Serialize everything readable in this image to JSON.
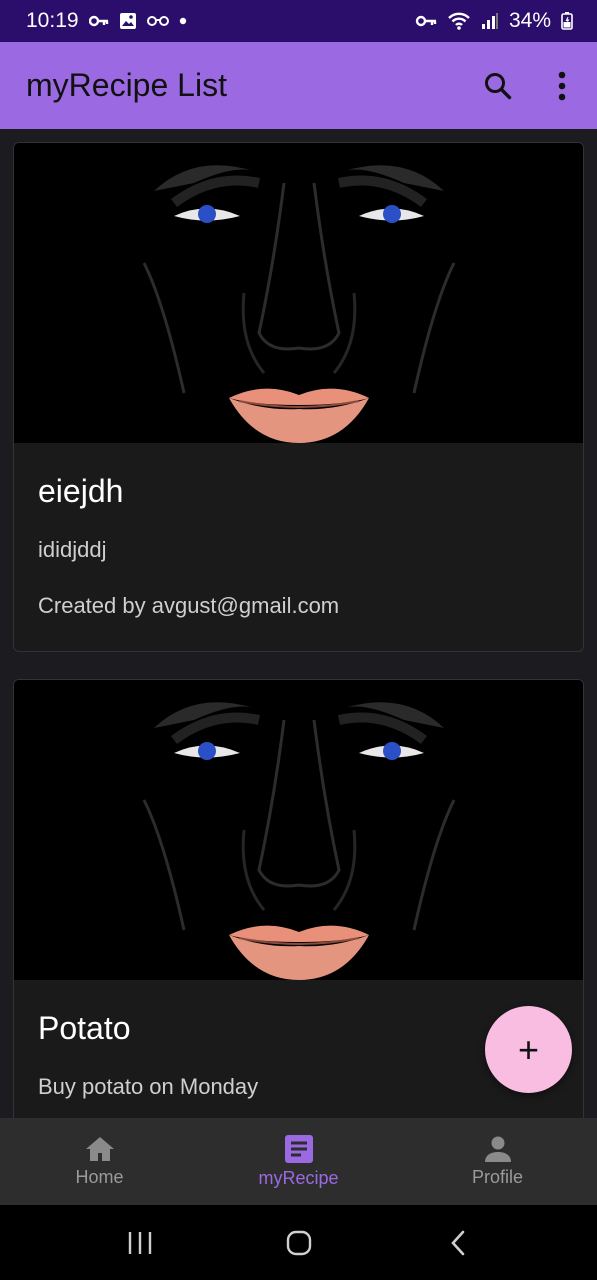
{
  "status_bar": {
    "time": "10:19",
    "battery": "34%",
    "left_icons": [
      "key-icon",
      "image-icon",
      "glasses-icon",
      "dot-icon"
    ],
    "right_icons": [
      "vpn-key-icon",
      "wifi-icon",
      "signal-icon",
      "battery-icon"
    ]
  },
  "app_bar": {
    "title": "myRecipe List",
    "actions": [
      "search-icon",
      "more-vert-icon"
    ]
  },
  "recipes": [
    {
      "title": "eiejdh",
      "description": "ididjddj",
      "created_by": "Created by avgust@gmail.com",
      "image": "face-illustration"
    },
    {
      "title": "Potato",
      "description": "Buy potato on Monday",
      "image": "face-illustration"
    }
  ],
  "fab": {
    "label": "+",
    "icon": "add-icon",
    "color": "#f8bde0"
  },
  "bottom_nav": {
    "items": [
      {
        "label": "Home",
        "icon": "home-icon",
        "active": false
      },
      {
        "label": "myRecipe",
        "icon": "article-icon",
        "active": true
      },
      {
        "label": "Profile",
        "icon": "person-icon",
        "active": false
      }
    ]
  },
  "colors": {
    "accent": "#9b6ae3",
    "status_bar": "#2b0d6b",
    "background": "#1c1b1f",
    "card": "#1a1a1a"
  },
  "system_nav": [
    "recents-icon",
    "home-circle-icon",
    "back-icon"
  ]
}
